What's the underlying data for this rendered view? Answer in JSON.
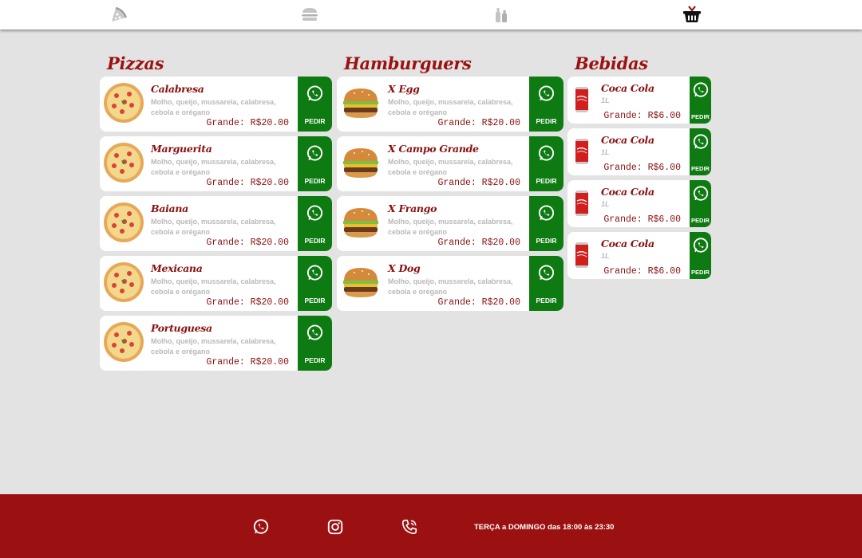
{
  "nav": {
    "items": [
      {
        "name": "pizza",
        "icon": "pizza-slice-icon"
      },
      {
        "name": "burger",
        "icon": "burger-icon"
      },
      {
        "name": "drinks",
        "icon": "bottles-icon"
      },
      {
        "name": "basket",
        "icon": "basket-icon"
      }
    ]
  },
  "sections": {
    "pizzas": {
      "title": "Pizzas",
      "items": [
        {
          "name": "Calabresa",
          "desc": "Molho, queijo, mussarela, calabresa, cebola e orégano",
          "price": "Grande: R$20.00",
          "order": "PEDIR"
        },
        {
          "name": "Marguerita",
          "desc": "Molho, queijo, mussarela, calabresa, cebola e orégano",
          "price": "Grande: R$20.00",
          "order": "PEDIR"
        },
        {
          "name": "Baiana",
          "desc": "Molho, queijo, mussarela, calabresa, cebola e orégano",
          "price": "Grande: R$20.00",
          "order": "PEDIR"
        },
        {
          "name": "Mexicana",
          "desc": "Molho, queijo, mussarela, calabresa, cebola e orégano",
          "price": "Grande: R$20.00",
          "order": "PEDIR"
        },
        {
          "name": "Portuguesa",
          "desc": "Molho, queijo, mussarela, calabresa, cebola e orégano",
          "price": "Grande: R$20.00",
          "order": "PEDIR"
        }
      ]
    },
    "burgers": {
      "title": "Hamburguers",
      "items": [
        {
          "name": "X Egg",
          "desc": "Molho, queijo, mussarela, calabresa, cebola e orégano",
          "price": "Grande: R$20.00",
          "order": "PEDIR"
        },
        {
          "name": "X Campo Grande",
          "desc": "Molho, queijo, mussarela, calabresa, cebola e orégano",
          "price": "Grande: R$20.00",
          "order": "PEDIR"
        },
        {
          "name": "X Frango",
          "desc": "Molho, queijo, mussarela, calabresa, cebola e orégano",
          "price": "Grande: R$20.00",
          "order": "PEDIR"
        },
        {
          "name": "X Dog",
          "desc": "Molho, queijo, mussarela, calabresa, cebola e orégano",
          "price": "Grande: R$20.00",
          "order": "PEDIR"
        }
      ]
    },
    "drinks": {
      "title": "Bebidas",
      "items": [
        {
          "name": "Coca Cola",
          "desc": "1L",
          "price": "Grande: R$6.00",
          "order": "PEDIR"
        },
        {
          "name": "Coca Cola",
          "desc": "1L",
          "price": "Grande: R$6.00",
          "order": "PEDIR"
        },
        {
          "name": "Coca Cola",
          "desc": "1L",
          "price": "Grande: R$6.00",
          "order": "PEDIR"
        },
        {
          "name": "Coca Cola",
          "desc": "1L",
          "price": "Grande: R$6.00",
          "order": "PEDIR"
        }
      ]
    }
  },
  "footer": {
    "icons": [
      "whatsapp-icon",
      "instagram-icon",
      "phone-icon"
    ],
    "hours": "TERÇA a DOMINGO das 18:00 às 23:30"
  },
  "colors": {
    "brand_red": "#9b1111",
    "order_green": "#0e7a12",
    "background": "#e3e3e3"
  }
}
